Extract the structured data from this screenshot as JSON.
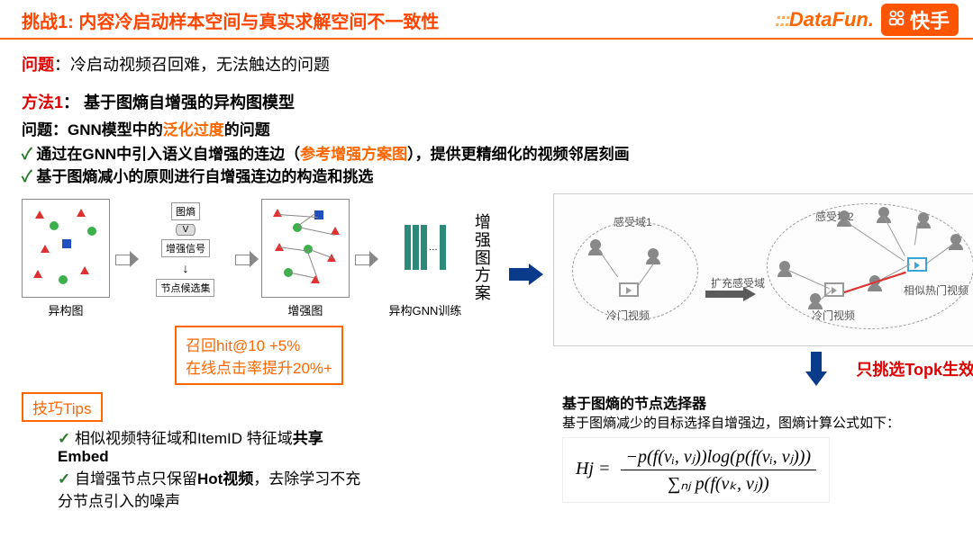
{
  "header": {
    "title": "挑战1: 内容冷启动样本空间与真实求解空间不一致性",
    "logo_datafun": "DataFun.",
    "logo_kuaishou": "快手"
  },
  "problem": {
    "label": "问题",
    "text": "：冷启动视频召回难，无法触达的问题"
  },
  "method": {
    "label": "方法1",
    "text": "：  基于图熵自增强的异构图模型"
  },
  "sub_problem": {
    "label": "问题：GNN模型中的",
    "emph": "泛化过度",
    "tail": "的问题"
  },
  "checks": [
    {
      "pre": "通过在GNN中引入语义自增强的连边（",
      "emph": "参考增强方案图",
      "post": "），提供更精细化的视频邻居刻画"
    },
    {
      "pre": "基于图熵减小的原则进行自增强连边的构造和挑选",
      "emph": "",
      "post": ""
    }
  ],
  "pipeline": {
    "heterograph": "异构图",
    "entropy": "图熵",
    "aug_signal": "增强信号",
    "candidate": "节点候选集",
    "aug_graph": "增强图",
    "gnn_train": "异构GNN训练",
    "aug_scheme_1": "增强",
    "aug_scheme_2": "图方",
    "aug_scheme_3": "案"
  },
  "receptive": {
    "field1": "感受域1",
    "field2": "感受域2",
    "expand": "扩充感受域",
    "cold_video": "冷门视频",
    "similar_hot": "相似热门视频"
  },
  "metrics": {
    "line1": "召回hit@10 +5%",
    "line2": "在线点击率提升20%+"
  },
  "tips": {
    "label": "技巧Tips",
    "items": [
      {
        "pre": "相似视频特征域和ItemID 特征域",
        "bold": "共享Embed",
        "post": ""
      },
      {
        "pre": "自增强节点只保留",
        "bold": "Hot视频",
        "post": "，去除学习不充分节点引入的噪声"
      }
    ]
  },
  "topk": "只挑选Topk生效",
  "selector": {
    "title": "基于图熵的节点选择器",
    "desc": "基于图熵减少的目标选择自增强边，图熵计算公式如下：",
    "formula_lhs": "Hj =",
    "formula_num": "−p(f(vᵢ, vⱼ))log(p(f(vᵢ, vⱼ)))",
    "formula_den": "∑ₙⱼ p(f(vₖ, vⱼ))"
  }
}
